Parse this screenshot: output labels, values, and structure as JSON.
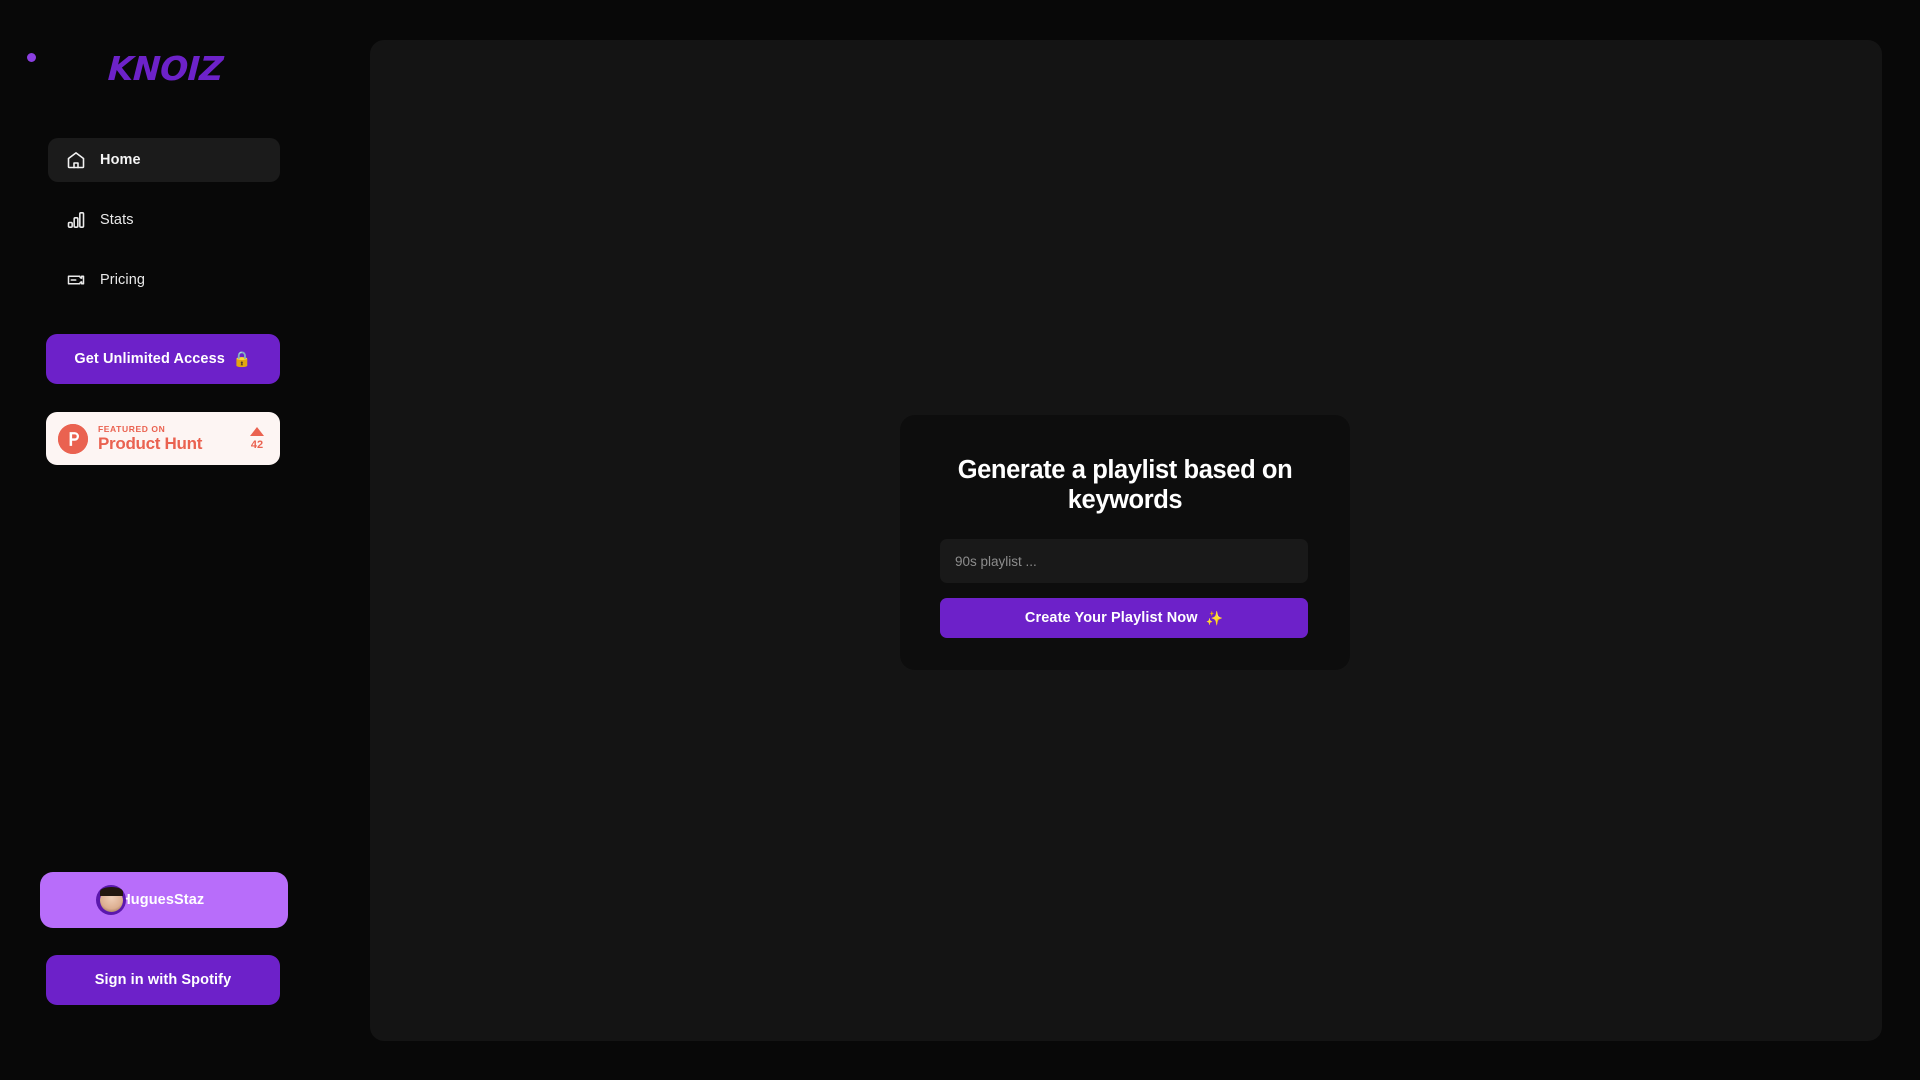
{
  "app": {
    "brand": "KNOIZ",
    "brand_color": "#6d22c9",
    "accent_purple": "#6d21c9",
    "background": "#080808",
    "panel_background": "#141414"
  },
  "sidebar": {
    "nav": [
      {
        "label": "Home",
        "icon": "home-icon",
        "active": true
      },
      {
        "label": "Stats",
        "icon": "bar-chart-icon",
        "active": false
      },
      {
        "label": "Pricing",
        "icon": "ticket-icon",
        "active": false
      }
    ],
    "unlimited_cta": {
      "label": "Get Unlimited Access",
      "emoji": "🔒",
      "color": "#6d21c9"
    },
    "product_hunt": {
      "featured_label": "FEATURED ON",
      "name": "Product Hunt",
      "upvotes": "42",
      "brand_color": "#ea6250",
      "background": "#fdf5f3"
    },
    "user": {
      "handle": "@HuguesStaz",
      "pill_color": "#b86dfa"
    },
    "spotify_button": {
      "label": "Sign in with Spotify",
      "color": "#6d21c9"
    }
  },
  "main": {
    "generator_card": {
      "title": "Generate a playlist based on keywords",
      "input_placeholder": "90s playlist ...",
      "input_value": "",
      "submit_label": "Create Your Playlist Now",
      "submit_emoji": "✨"
    }
  }
}
